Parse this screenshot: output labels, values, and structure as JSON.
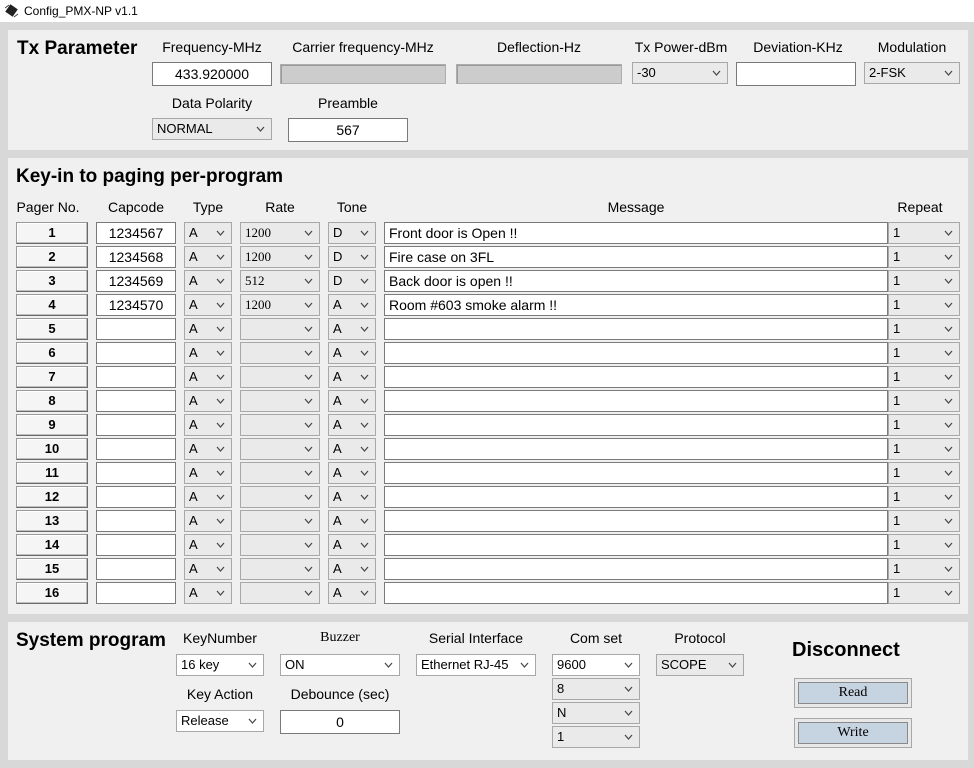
{
  "window": {
    "title": "Config_PMX-NP v1.1"
  },
  "tx": {
    "title": "Tx Parameter",
    "labels": {
      "frequency": "Frequency-MHz",
      "carrier": "Carrier frequency-MHz",
      "deflection": "Deflection-Hz",
      "power": "Tx Power-dBm",
      "deviation": "Deviation-KHz",
      "modulation": "Modulation",
      "polarity": "Data Polarity",
      "preamble": "Preamble"
    },
    "values": {
      "frequency": "433.920000",
      "carrier": "",
      "deflection": "",
      "power": "-30",
      "deviation": "",
      "modulation": "2-FSK",
      "polarity": "NORMAL",
      "preamble": "567"
    }
  },
  "paging": {
    "title": "Key-in to paging per-program",
    "headers": {
      "pager": "Pager No.",
      "capcode": "Capcode",
      "type": "Type",
      "rate": "Rate",
      "tone": "Tone",
      "message": "Message",
      "repeat": "Repeat"
    },
    "rows": [
      {
        "no": "1",
        "capcode": "1234567",
        "type": "A",
        "rate": "1200",
        "tone": "D",
        "message": "Front door is Open !!",
        "repeat": "1"
      },
      {
        "no": "2",
        "capcode": "1234568",
        "type": "A",
        "rate": "1200",
        "tone": "D",
        "message": "Fire case on 3FL",
        "repeat": "1"
      },
      {
        "no": "3",
        "capcode": "1234569",
        "type": "A",
        "rate": "512",
        "tone": "D",
        "message": "Back door is open !!",
        "repeat": "1"
      },
      {
        "no": "4",
        "capcode": "1234570",
        "type": "A",
        "rate": "1200",
        "tone": "A",
        "message": "Room #603 smoke alarm !!",
        "repeat": "1"
      },
      {
        "no": "5",
        "capcode": "",
        "type": "A",
        "rate": "",
        "tone": "A",
        "message": "",
        "repeat": "1"
      },
      {
        "no": "6",
        "capcode": "",
        "type": "A",
        "rate": "",
        "tone": "A",
        "message": "",
        "repeat": "1"
      },
      {
        "no": "7",
        "capcode": "",
        "type": "A",
        "rate": "",
        "tone": "A",
        "message": "",
        "repeat": "1"
      },
      {
        "no": "8",
        "capcode": "",
        "type": "A",
        "rate": "",
        "tone": "A",
        "message": "",
        "repeat": "1"
      },
      {
        "no": "9",
        "capcode": "",
        "type": "A",
        "rate": "",
        "tone": "A",
        "message": "",
        "repeat": "1"
      },
      {
        "no": "10",
        "capcode": "",
        "type": "A",
        "rate": "",
        "tone": "A",
        "message": "",
        "repeat": "1"
      },
      {
        "no": "11",
        "capcode": "",
        "type": "A",
        "rate": "",
        "tone": "A",
        "message": "",
        "repeat": "1"
      },
      {
        "no": "12",
        "capcode": "",
        "type": "A",
        "rate": "",
        "tone": "A",
        "message": "",
        "repeat": "1"
      },
      {
        "no": "13",
        "capcode": "",
        "type": "A",
        "rate": "",
        "tone": "A",
        "message": "",
        "repeat": "1"
      },
      {
        "no": "14",
        "capcode": "",
        "type": "A",
        "rate": "",
        "tone": "A",
        "message": "",
        "repeat": "1"
      },
      {
        "no": "15",
        "capcode": "",
        "type": "A",
        "rate": "",
        "tone": "A",
        "message": "",
        "repeat": "1"
      },
      {
        "no": "16",
        "capcode": "",
        "type": "A",
        "rate": "",
        "tone": "A",
        "message": "",
        "repeat": "1"
      }
    ]
  },
  "system": {
    "title": "System program",
    "labels": {
      "keynumber": "KeyNumber",
      "buzzer": "Buzzer",
      "serial": "Serial Interface",
      "comset": "Com set",
      "protocol": "Protocol",
      "keyaction": "Key Action",
      "debounce": "Debounce (sec)"
    },
    "values": {
      "keynumber": "16 key",
      "buzzer": "ON",
      "serial": "Ethernet RJ-45",
      "baud": "9600",
      "databits": "8",
      "parity": "N",
      "stopbits": "1",
      "protocol": "SCOPE",
      "keyaction": "Release",
      "debounce": "0"
    },
    "status": "Disconnect",
    "read_label": "Read",
    "write_label": "Write"
  },
  "icons": {
    "app": "chip-icon",
    "dropdown": "chevron-down-icon"
  }
}
